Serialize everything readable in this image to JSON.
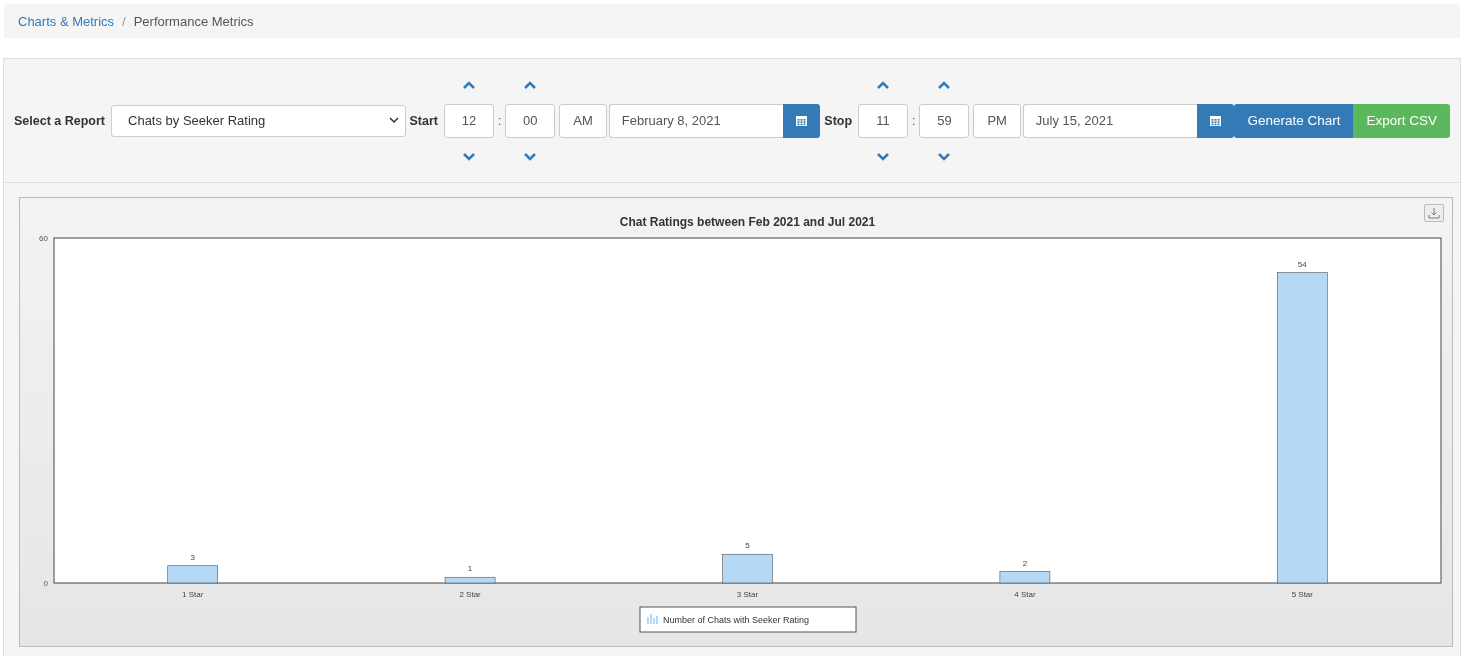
{
  "breadcrumb_separator": "/",
  "breadcrumb": [
    {
      "label": "Charts & Metrics",
      "kind": "link"
    },
    {
      "label": "Performance Metrics",
      "kind": "current"
    }
  ],
  "filters": {
    "report_label": "Select a Report",
    "report_value": "Chats by Seeker Rating",
    "start": {
      "label": "Start",
      "hour": "12",
      "minute": "00",
      "period": "AM",
      "date": "February 8, 2021"
    },
    "stop": {
      "label": "Stop",
      "hour": "11",
      "minute": "59",
      "period": "PM",
      "date": "July 15, 2021"
    },
    "time_separator": ":",
    "buttons": [
      {
        "label": "Generate Chart",
        "kind": "primary"
      },
      {
        "label": "Export CSV",
        "kind": "success"
      }
    ]
  },
  "chart": {
    "chart_data": {
      "type": "bar",
      "title": "Chat Ratings between Feb 2021 and Jul 2021",
      "categories": [
        "1 Star",
        "2 Star",
        "3 Star",
        "4 Star",
        "5 Star"
      ],
      "series": [
        {
          "name": "Number of Chats with Seeker Rating",
          "color": "#b3d9f7",
          "values": [
            3,
            1,
            5,
            2,
            54
          ]
        }
      ],
      "ylim": [
        0,
        60
      ],
      "yticks": [
        0,
        60
      ],
      "data_labels": true
    }
  }
}
